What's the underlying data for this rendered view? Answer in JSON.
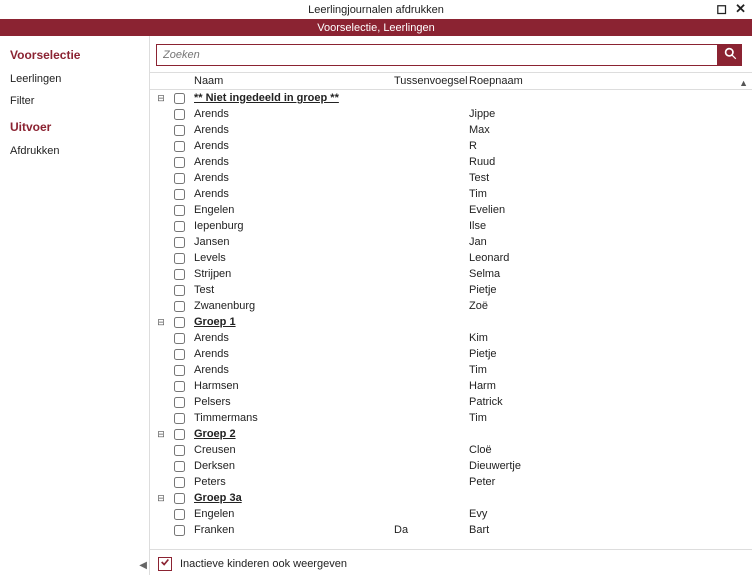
{
  "window": {
    "title": "Leerlingjournalen afdrukken",
    "subheader": "Voorselectie, Leerlingen"
  },
  "sidebar": {
    "sections": [
      {
        "header": "Voorselectie",
        "items": [
          {
            "label": "Leerlingen",
            "active": true
          },
          {
            "label": "Filter",
            "active": false
          }
        ]
      },
      {
        "header": "Uitvoer",
        "items": [
          {
            "label": "Afdrukken",
            "active": false
          }
        ]
      }
    ]
  },
  "search": {
    "placeholder": "Zoeken",
    "value": ""
  },
  "columns": {
    "naam": "Naam",
    "tussenvoegsel": "Tussenvoegsel",
    "roepnaam": "Roepnaam"
  },
  "rows": [
    {
      "type": "group",
      "naam": "** Niet ingedeeld in groep **"
    },
    {
      "type": "person",
      "naam": "Arends",
      "tv": "",
      "roepnaam": "Jippe"
    },
    {
      "type": "person",
      "naam": "Arends",
      "tv": "",
      "roepnaam": "Max"
    },
    {
      "type": "person",
      "naam": "Arends",
      "tv": "",
      "roepnaam": "R"
    },
    {
      "type": "person",
      "naam": "Arends",
      "tv": "",
      "roepnaam": "Ruud"
    },
    {
      "type": "person",
      "naam": "Arends",
      "tv": "",
      "roepnaam": "Test"
    },
    {
      "type": "person",
      "naam": "Arends",
      "tv": "",
      "roepnaam": "Tim"
    },
    {
      "type": "person",
      "naam": "Engelen",
      "tv": "",
      "roepnaam": "Evelien"
    },
    {
      "type": "person",
      "naam": "Iepenburg",
      "tv": "",
      "roepnaam": "Ilse"
    },
    {
      "type": "person",
      "naam": "Jansen",
      "tv": "",
      "roepnaam": "Jan"
    },
    {
      "type": "person",
      "naam": "Levels",
      "tv": "",
      "roepnaam": "Leonard"
    },
    {
      "type": "person",
      "naam": "Strijpen",
      "tv": "",
      "roepnaam": "Selma"
    },
    {
      "type": "person",
      "naam": "Test",
      "tv": "",
      "roepnaam": "Pietje"
    },
    {
      "type": "person",
      "naam": "Zwanenburg",
      "tv": "",
      "roepnaam": "Zoë"
    },
    {
      "type": "group",
      "naam": "Groep 1"
    },
    {
      "type": "person",
      "naam": "Arends",
      "tv": "",
      "roepnaam": "Kim"
    },
    {
      "type": "person",
      "naam": "Arends",
      "tv": "",
      "roepnaam": "Pietje"
    },
    {
      "type": "person",
      "naam": "Arends",
      "tv": "",
      "roepnaam": "Tim"
    },
    {
      "type": "person",
      "naam": "Harmsen",
      "tv": "",
      "roepnaam": "Harm"
    },
    {
      "type": "person",
      "naam": "Pelsers",
      "tv": "",
      "roepnaam": "Patrick"
    },
    {
      "type": "person",
      "naam": "Timmermans",
      "tv": "",
      "roepnaam": "Tim"
    },
    {
      "type": "group",
      "naam": "Groep 2"
    },
    {
      "type": "person",
      "naam": "Creusen",
      "tv": "",
      "roepnaam": "Cloë"
    },
    {
      "type": "person",
      "naam": "Derksen",
      "tv": "",
      "roepnaam": "Dieuwertje"
    },
    {
      "type": "person",
      "naam": "Peters",
      "tv": "",
      "roepnaam": "Peter"
    },
    {
      "type": "group",
      "naam": "Groep 3a"
    },
    {
      "type": "person",
      "naam": "Engelen",
      "tv": "",
      "roepnaam": "Evy"
    },
    {
      "type": "person",
      "naam": "Franken",
      "tv": "Da",
      "roepnaam": "Bart"
    }
  ],
  "footer": {
    "inactive_label": "Inactieve kinderen ook weergeven",
    "inactive_checked": true
  }
}
